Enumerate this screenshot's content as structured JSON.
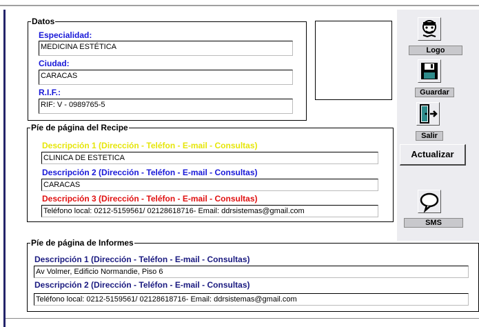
{
  "datos": {
    "legend": "Datos",
    "especialidad_label": "Especialidad:",
    "especialidad_value": "MEDICINA ESTÉTICA",
    "ciudad_label": "Ciudad:",
    "ciudad_value": "CARACAS",
    "rif_label": "R.I.F.:",
    "rif_value": "RIF: V - 0989765-5"
  },
  "toolbar": {
    "logo_label": "Logo",
    "guardar_label": "Guardar",
    "salir_label": "Salir",
    "actualizar_label": "Actualizar",
    "sms_label": "SMS"
  },
  "recipe_footer": {
    "legend": "Píe de página del Recipe",
    "desc1_label": "Descripción 1  (Dirección - Teléfon - E-mail - Consultas)",
    "desc1_value": "CLINICA DE ESTETICA",
    "desc2_label": "Descripción 2  (Dirección - Teléfon - E-mail - Consultas)",
    "desc2_value": "CARACAS",
    "desc3_label": "Descripción 3  (Dirección - Teléfon - E-mail - Consultas)",
    "desc3_value": "Teléfono local: 0212-5159561/ 02128618716- Email: ddrsistemas@gmail.com"
  },
  "informes_footer": {
    "legend": "Píe de página de Informes",
    "desc1_label": "Descripción 1  (Dirección - Teléfon - E-mail - Consultas)",
    "desc1_value": "Av Volmer, Edificio  Normandie, Piso 6",
    "desc2_label": "Descripción 2  (Dirección - Teléfon - E-mail - Consultas)",
    "desc2_value": "Teléfono local: 0212-5159561/ 02128618716- Email: ddrsistemas@gmail.com"
  },
  "colors": {
    "blue_label": "#1818d8",
    "yellow_label": "#e6e60a",
    "red_label": "#e01010",
    "navy_label": "#1a1a80",
    "panel": "#ececf0"
  },
  "icons": [
    "logo-icon",
    "save-icon",
    "exit-icon",
    "sms-icon"
  ]
}
